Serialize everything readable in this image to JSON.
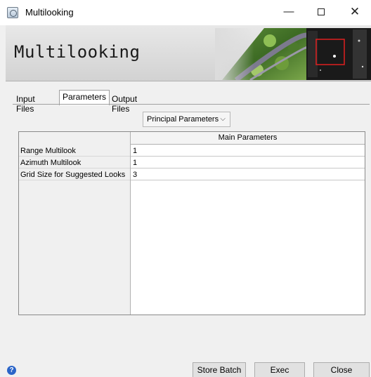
{
  "window": {
    "title": "Multilooking",
    "minimize_glyph": "—",
    "close_glyph": "✕"
  },
  "banner": {
    "title": "Multilooking"
  },
  "tabs": [
    {
      "label": "Input Files",
      "active": false
    },
    {
      "label": "Parameters",
      "active": true
    },
    {
      "label": "Output Files",
      "active": false
    }
  ],
  "dropdown": {
    "selected": "Principal Parameters",
    "chevron": "⌵"
  },
  "table": {
    "header": "Main Parameters",
    "rows": [
      {
        "label": "Range Multilook",
        "value": "1"
      },
      {
        "label": "Azimuth Multilook",
        "value": "1"
      },
      {
        "label": "Grid Size for Suggested Looks",
        "value": "3"
      }
    ]
  },
  "footer": {
    "help_glyph": "?",
    "store_batch_label": "Store Batch",
    "exec_label": "Exec",
    "close_label": "Close"
  },
  "icons": {
    "app": "app-window-icon",
    "help": "help-icon"
  },
  "colors": {
    "help_blue": "#2a64c8",
    "selection_red": "#e02020"
  }
}
